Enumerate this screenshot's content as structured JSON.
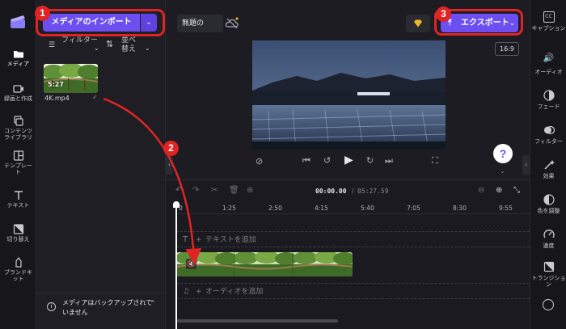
{
  "left_rail": {
    "items": [
      {
        "label": "メディア",
        "icon": "folder-icon"
      },
      {
        "label": "録画と作成",
        "icon": "camera-icon"
      },
      {
        "label": "コンテンツライブラリ",
        "icon": "library-icon"
      },
      {
        "label": "テンプレート",
        "icon": "template-icon"
      },
      {
        "label": "テキスト",
        "icon": "text-icon"
      },
      {
        "label": "切り替え",
        "icon": "transition-icon"
      },
      {
        "label": "ブランドキット",
        "icon": "brand-kit-icon"
      }
    ]
  },
  "media_panel": {
    "import_label": "メディアのインポート",
    "filter_label": "フィルター",
    "sort_label": "並べ替え",
    "clip": {
      "duration": "5:27",
      "filename": "4K.mp4"
    },
    "backup_notice": "メディアはバックアップされていません"
  },
  "topbar": {
    "project_title": "無題の",
    "export_label": "エクスポート",
    "aspect_ratio": "16:9"
  },
  "player": {
    "help_label": "?"
  },
  "timeline": {
    "current_time": "00:00.00",
    "total_time": "05:27.59",
    "ticks": [
      "0",
      "1:25",
      "2:50",
      "4:15",
      "5:40",
      "7:05",
      "8:30",
      "9:55"
    ],
    "text_track_label": "テキストを追加",
    "audio_track_label": "オーディオを追加"
  },
  "right_rail": {
    "items": [
      {
        "label": "キャプション",
        "icon": "captions-icon"
      },
      {
        "label": "オーディオ",
        "icon": "audio-icon"
      },
      {
        "label": "フェード",
        "icon": "fade-icon"
      },
      {
        "label": "フィルター",
        "icon": "filter-icon"
      },
      {
        "label": "効果",
        "icon": "effects-icon"
      },
      {
        "label": "色を調整",
        "icon": "color-icon"
      },
      {
        "label": "速度",
        "icon": "speed-icon"
      },
      {
        "label": "トランジション",
        "icon": "transition-icon"
      }
    ]
  },
  "annotations": {
    "badge1": "1",
    "badge2": "2",
    "badge3": "3"
  },
  "colors": {
    "accent": "#6b4ff0",
    "annotation": "#e02424"
  }
}
